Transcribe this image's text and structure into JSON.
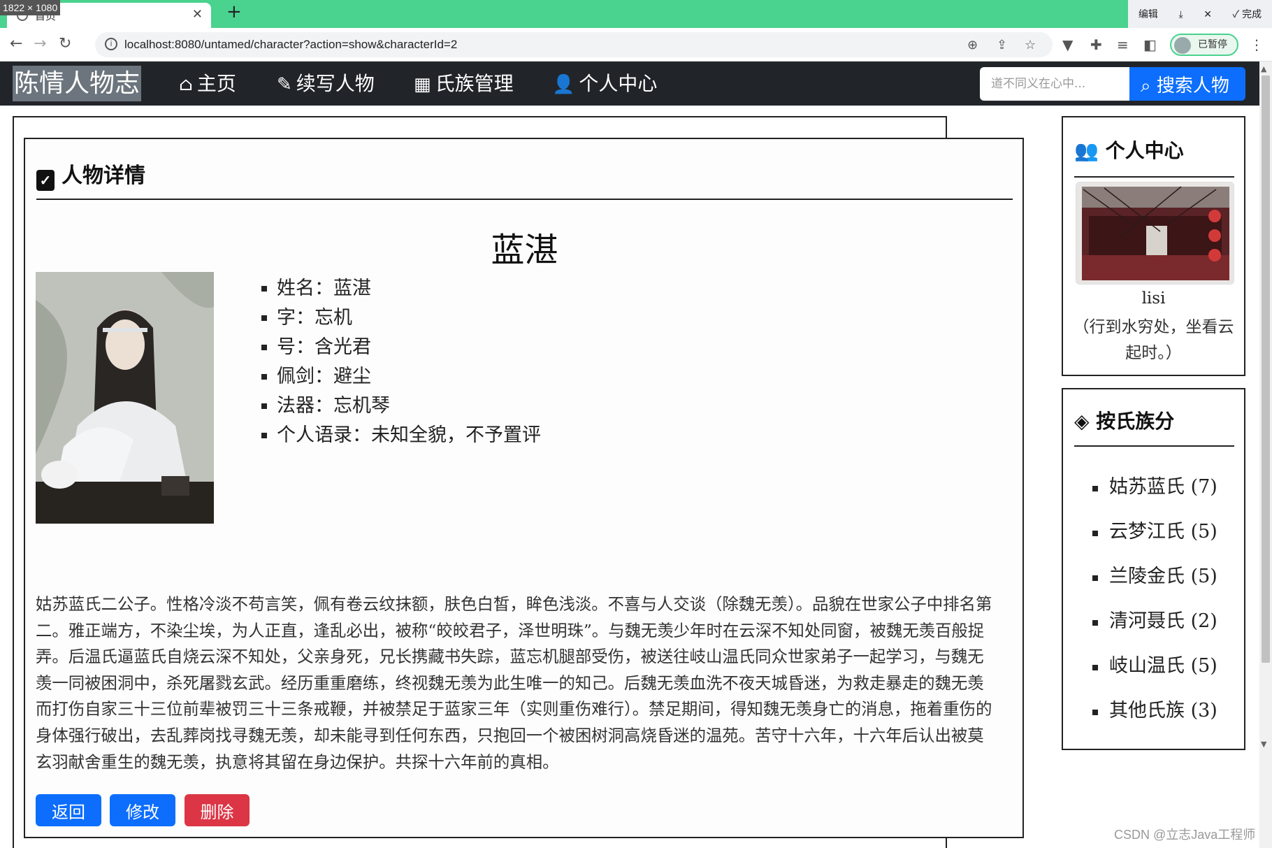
{
  "browser": {
    "size_badge": "1822 × 1080",
    "tab_title": "首页",
    "new_tab_label": "+",
    "url": "localhost:8080/untamed/character?action=show&characterId=2",
    "download_panel": {
      "edit": "编辑",
      "done": "✓ 完成"
    },
    "profile_status": "已暂停"
  },
  "navbar": {
    "brand": "陈情人物志",
    "links": [
      {
        "label": "主页",
        "icon": "home-icon"
      },
      {
        "label": "续写人物",
        "icon": "edit-icon"
      },
      {
        "label": "氏族管理",
        "icon": "grid-icon"
      },
      {
        "label": "个人中心",
        "icon": "user-icon"
      }
    ],
    "search": {
      "placeholder": "道不同义在心中...",
      "button": "搜索人物"
    }
  },
  "detail": {
    "header": "人物详情",
    "name": "蓝湛",
    "attributes": [
      "姓名：蓝湛",
      "字：忘机",
      "号：含光君",
      "佩剑：避尘",
      "法器：忘机琴",
      "个人语录：未知全貌，不予置评"
    ],
    "bio": "姑苏蓝氏二公子。性格冷淡不苟言笑，佩有卷云纹抹额，肤色白皙，眸色浅淡。不喜与人交谈（除魏无羡）。品貌在世家公子中排名第二。雅正端方，不染尘埃，为人正直，逢乱必出，被称“皎皎君子，泽世明珠”。与魏无羡少年时在云深不知处同窗，被魏无羡百般捉弄。后温氏逼蓝氏自烧云深不知处，父亲身死，兄长携藏书失踪，蓝忘机腿部受伤，被送往岐山温氏同众世家弟子一起学习，与魏无羡一同被困洞中，杀死屠戮玄武。经历重重磨练，终视魏无羡为此生唯一的知己。后魏无羡血洗不夜天城昏迷，为救走暴走的魏无羡而打伤自家三十三位前辈被罚三十三条戒鞭，并被禁足于蓝家三年（实则重伤难行）。禁足期间，得知魏无羡身亡的消息，拖着重伤的身体强行破出，去乱葬岗找寻魏无羡，却未能寻到任何东西，只抱回一个被困树洞高烧昏迷的温苑。苦守十六年，十六年后认出被莫玄羽献舍重生的魏无羡，执意将其留在身边保护。共探十六年前的真相。",
    "buttons": {
      "back": "返回",
      "edit": "修改",
      "delete": "删除"
    }
  },
  "sidebar": {
    "profile": {
      "header": "个人中心",
      "username": "lisi",
      "motto": "（行到水穷处，坐看云起时。）"
    },
    "clans": {
      "header": "按氏族分",
      "items": [
        "姑苏蓝氏 (7)",
        "云梦江氏 (5)",
        "兰陵金氏 (5)",
        "清河聂氏 (2)",
        "岐山温氏 (5)",
        "其他氏族 (3)"
      ]
    }
  },
  "watermark": "CSDN @立志Java工程师",
  "colors": {
    "navbar": "#212529",
    "primary": "#0d6efd",
    "danger": "#dc3545",
    "chrome": "#4ad28f"
  }
}
